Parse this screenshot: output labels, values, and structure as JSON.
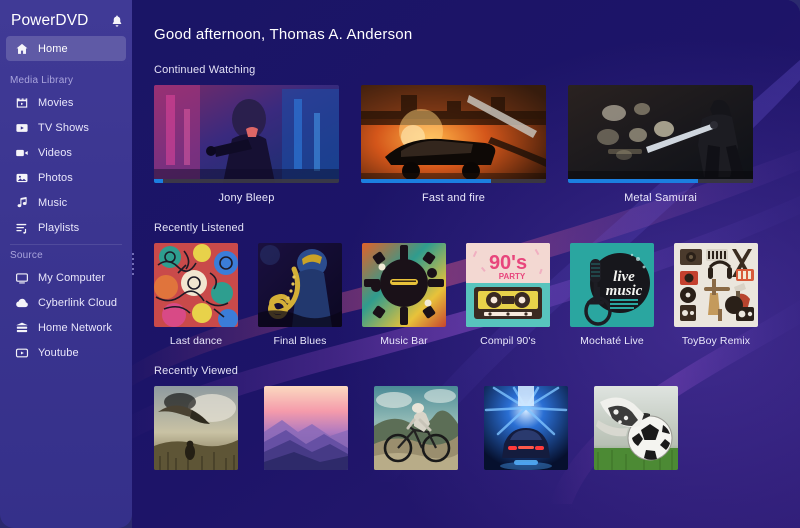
{
  "app": {
    "brand": "PowerDVD",
    "notification_icon": "bell-icon",
    "accent": "#1b7fe0",
    "sidebar_bg": "#3b3590",
    "main_bg": "#191463"
  },
  "sidebar": {
    "home": {
      "label": "Home",
      "icon": "home-icon",
      "active": true
    },
    "groups": [
      {
        "title": "Media Library",
        "items": [
          {
            "label": "Movies",
            "icon": "movie-clapper-icon"
          },
          {
            "label": "TV Shows",
            "icon": "tv-icon"
          },
          {
            "label": "Videos",
            "icon": "video-camera-icon"
          },
          {
            "label": "Photos",
            "icon": "photo-icon"
          },
          {
            "label": "Music",
            "icon": "music-note-icon"
          },
          {
            "label": "Playlists",
            "icon": "playlist-icon"
          }
        ]
      },
      {
        "title": "Source",
        "items": [
          {
            "label": "My Computer",
            "icon": "monitor-icon"
          },
          {
            "label": "Cyberlink Cloud",
            "icon": "cloud-icon"
          },
          {
            "label": "Home Network",
            "icon": "network-server-icon"
          },
          {
            "label": "Youtube",
            "icon": "youtube-play-icon"
          }
        ]
      }
    ],
    "resize_handle": "sidebar-resize-handle"
  },
  "main": {
    "greeting": "Good afternoon, Thomas A. Anderson",
    "sections": [
      {
        "id": "continued-watching",
        "title": "Continued Watching",
        "items": [
          {
            "title": "Jony Bleep",
            "progress": 5,
            "art": "neon-gunman"
          },
          {
            "title": "Fast and fire",
            "progress": 70,
            "art": "burning-car-chase"
          },
          {
            "title": "Metal Samurai",
            "progress": 70,
            "art": "samurai-night-city"
          }
        ]
      },
      {
        "id": "recently-listened",
        "title": "Recently Listened",
        "items": [
          {
            "title": "Last dance",
            "art": "doodle-collage"
          },
          {
            "title": "Final Blues",
            "art": "saxophone-player"
          },
          {
            "title": "Music Bar",
            "art": "instruments-burst"
          },
          {
            "title": "Compil 90's",
            "art": "cassette-tape-90s"
          },
          {
            "title": "Mochaté Live",
            "art": "live-music-teal"
          },
          {
            "title": "ToyBoy Remix",
            "art": "gear-flatlay"
          }
        ]
      },
      {
        "id": "recently-viewed",
        "title": "Recently Viewed",
        "items": [
          {
            "title": "",
            "art": "eagle-field"
          },
          {
            "title": "",
            "art": "pink-mountains"
          },
          {
            "title": "",
            "art": "mountain-biker"
          },
          {
            "title": "",
            "art": "blue-tunnel-car"
          },
          {
            "title": "",
            "art": "soccer-ball-cleat"
          }
        ]
      }
    ]
  }
}
